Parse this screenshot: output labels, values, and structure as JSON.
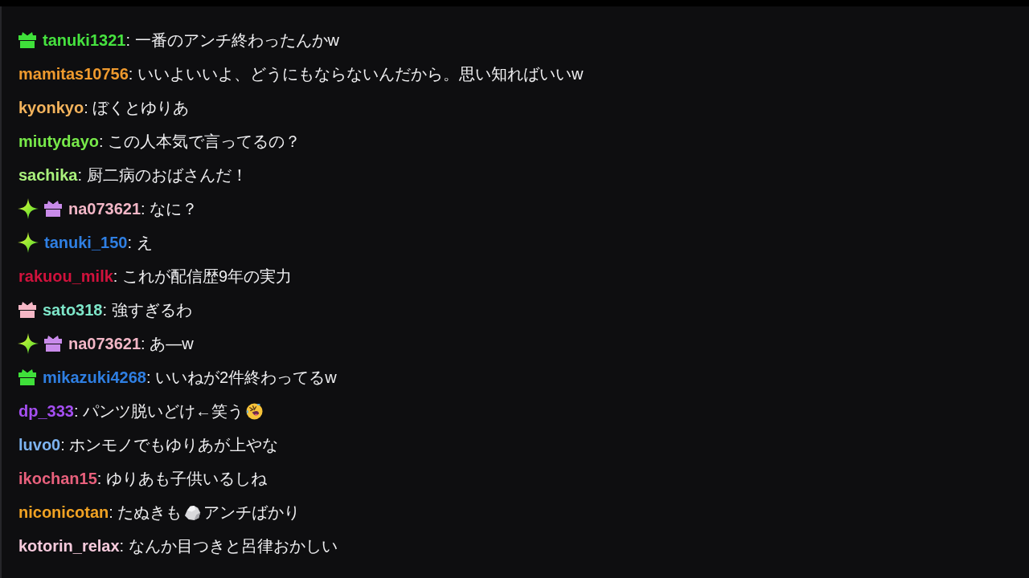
{
  "chat": {
    "messages": [
      {
        "badges": [
          {
            "kind": "gift",
            "color": "#3fe03a"
          }
        ],
        "user": "tanuki1321",
        "color": "#46e23f",
        "parts": [
          {
            "kind": "text",
            "text": ": 一番のアンチ終わったんかw"
          }
        ]
      },
      {
        "user": "mamitas10756",
        "color": "#ef9a2e",
        "parts": [
          {
            "kind": "text",
            "text": ": いいよいいよ、どうにもならないんだから。思い知ればいいw"
          }
        ]
      },
      {
        "user": "kyonkyo",
        "color": "#f3b35c",
        "parts": [
          {
            "kind": "text",
            "text": ": ぼくとゆりあ"
          }
        ]
      },
      {
        "user": "miutydayo",
        "color": "#78ea4a",
        "parts": [
          {
            "kind": "text",
            "text": ": この人本気で言ってるの？"
          }
        ]
      },
      {
        "user": "sachika",
        "color": "#a9f07c",
        "parts": [
          {
            "kind": "text",
            "text": ": 厨二病のおばさんだ！"
          }
        ]
      },
      {
        "badges": [
          {
            "kind": "sparkle"
          },
          {
            "kind": "gift",
            "color": "#c98bea"
          }
        ],
        "user": "na073621",
        "color": "#f2b6c6",
        "parts": [
          {
            "kind": "text",
            "text": ": なに？"
          }
        ]
      },
      {
        "badges": [
          {
            "kind": "sparkle"
          }
        ],
        "user": "tanuki_150",
        "color": "#2f7fe2",
        "parts": [
          {
            "kind": "text",
            "text": ": え"
          }
        ]
      },
      {
        "user": "rakuou_milk",
        "color": "#d0123c",
        "parts": [
          {
            "kind": "text",
            "text": ": これが配信歴9年の実力"
          }
        ]
      },
      {
        "badges": [
          {
            "kind": "gift",
            "color": "#f5b7c6"
          }
        ],
        "user": "sato318",
        "color": "#7ee6c9",
        "parts": [
          {
            "kind": "text",
            "text": ": 強すぎるわ"
          }
        ]
      },
      {
        "badges": [
          {
            "kind": "sparkle"
          },
          {
            "kind": "gift",
            "color": "#c98bea"
          }
        ],
        "user": "na073621",
        "color": "#f2b6c6",
        "parts": [
          {
            "kind": "text",
            "text": ": あ—w"
          }
        ]
      },
      {
        "badges": [
          {
            "kind": "gift",
            "color": "#3fe03a"
          }
        ],
        "user": "mikazuki4268",
        "color": "#2f7fe2",
        "parts": [
          {
            "kind": "text",
            "text": ": いいねが2件終わってるw"
          }
        ]
      },
      {
        "user": "dp_333",
        "color": "#a54ff2",
        "parts": [
          {
            "kind": "text",
            "text": ": パンツ脱いどけ←笑う"
          },
          {
            "kind": "emoji"
          }
        ]
      },
      {
        "user": "luvo0",
        "color": "#7db3f0",
        "parts": [
          {
            "kind": "text",
            "text": ": ホンモノでもゆりあが上やな"
          }
        ]
      },
      {
        "user": "ikochan15",
        "color": "#e8607c",
        "parts": [
          {
            "kind": "text",
            "text": ": ゆりあも子供いるしね"
          }
        ]
      },
      {
        "user": "niconicotan",
        "color": "#f0a223",
        "parts": [
          {
            "kind": "text",
            "text": ": たぬきも"
          },
          {
            "kind": "emote"
          },
          {
            "kind": "text",
            "text": "アンチばかり"
          }
        ]
      },
      {
        "user": "kotorin_relax",
        "color": "#f6cadc",
        "parts": [
          {
            "kind": "text",
            "text": ": なんか目つきと呂律おかしい"
          }
        ]
      }
    ]
  }
}
